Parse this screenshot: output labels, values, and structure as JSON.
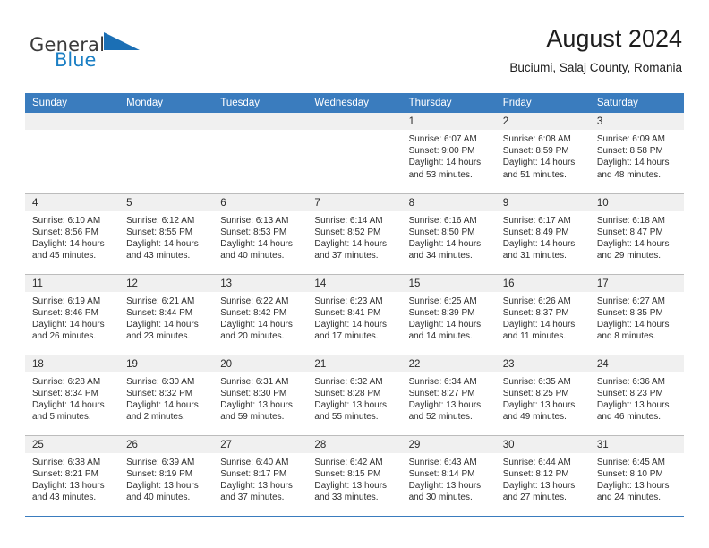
{
  "brand": {
    "name_part1": "General",
    "name_part2": "Blue",
    "accent_color": "#1b7fc4",
    "logo_icon": "triangle-flag-icon"
  },
  "header": {
    "title": "August 2024",
    "subtitle": "Buciumi, Salaj County, Romania",
    "header_bg_color": "#3a7cbe",
    "daynum_band_color": "#f0f0f0"
  },
  "weekdays": [
    "Sunday",
    "Monday",
    "Tuesday",
    "Wednesday",
    "Thursday",
    "Friday",
    "Saturday"
  ],
  "labels": {
    "sunrise_prefix": "Sunrise:",
    "sunset_prefix": "Sunset:",
    "daylight_prefix": "Daylight:"
  },
  "weeks": [
    [
      {
        "blank": true
      },
      {
        "blank": true
      },
      {
        "blank": true
      },
      {
        "blank": true
      },
      {
        "day": "1",
        "sunrise": "Sunrise: 6:07 AM",
        "sunset": "Sunset: 9:00 PM",
        "daylight1": "Daylight: 14 hours",
        "daylight2": "and 53 minutes."
      },
      {
        "day": "2",
        "sunrise": "Sunrise: 6:08 AM",
        "sunset": "Sunset: 8:59 PM",
        "daylight1": "Daylight: 14 hours",
        "daylight2": "and 51 minutes."
      },
      {
        "day": "3",
        "sunrise": "Sunrise: 6:09 AM",
        "sunset": "Sunset: 8:58 PM",
        "daylight1": "Daylight: 14 hours",
        "daylight2": "and 48 minutes."
      }
    ],
    [
      {
        "day": "4",
        "sunrise": "Sunrise: 6:10 AM",
        "sunset": "Sunset: 8:56 PM",
        "daylight1": "Daylight: 14 hours",
        "daylight2": "and 45 minutes."
      },
      {
        "day": "5",
        "sunrise": "Sunrise: 6:12 AM",
        "sunset": "Sunset: 8:55 PM",
        "daylight1": "Daylight: 14 hours",
        "daylight2": "and 43 minutes."
      },
      {
        "day": "6",
        "sunrise": "Sunrise: 6:13 AM",
        "sunset": "Sunset: 8:53 PM",
        "daylight1": "Daylight: 14 hours",
        "daylight2": "and 40 minutes."
      },
      {
        "day": "7",
        "sunrise": "Sunrise: 6:14 AM",
        "sunset": "Sunset: 8:52 PM",
        "daylight1": "Daylight: 14 hours",
        "daylight2": "and 37 minutes."
      },
      {
        "day": "8",
        "sunrise": "Sunrise: 6:16 AM",
        "sunset": "Sunset: 8:50 PM",
        "daylight1": "Daylight: 14 hours",
        "daylight2": "and 34 minutes."
      },
      {
        "day": "9",
        "sunrise": "Sunrise: 6:17 AM",
        "sunset": "Sunset: 8:49 PM",
        "daylight1": "Daylight: 14 hours",
        "daylight2": "and 31 minutes."
      },
      {
        "day": "10",
        "sunrise": "Sunrise: 6:18 AM",
        "sunset": "Sunset: 8:47 PM",
        "daylight1": "Daylight: 14 hours",
        "daylight2": "and 29 minutes."
      }
    ],
    [
      {
        "day": "11",
        "sunrise": "Sunrise: 6:19 AM",
        "sunset": "Sunset: 8:46 PM",
        "daylight1": "Daylight: 14 hours",
        "daylight2": "and 26 minutes."
      },
      {
        "day": "12",
        "sunrise": "Sunrise: 6:21 AM",
        "sunset": "Sunset: 8:44 PM",
        "daylight1": "Daylight: 14 hours",
        "daylight2": "and 23 minutes."
      },
      {
        "day": "13",
        "sunrise": "Sunrise: 6:22 AM",
        "sunset": "Sunset: 8:42 PM",
        "daylight1": "Daylight: 14 hours",
        "daylight2": "and 20 minutes."
      },
      {
        "day": "14",
        "sunrise": "Sunrise: 6:23 AM",
        "sunset": "Sunset: 8:41 PM",
        "daylight1": "Daylight: 14 hours",
        "daylight2": "and 17 minutes."
      },
      {
        "day": "15",
        "sunrise": "Sunrise: 6:25 AM",
        "sunset": "Sunset: 8:39 PM",
        "daylight1": "Daylight: 14 hours",
        "daylight2": "and 14 minutes."
      },
      {
        "day": "16",
        "sunrise": "Sunrise: 6:26 AM",
        "sunset": "Sunset: 8:37 PM",
        "daylight1": "Daylight: 14 hours",
        "daylight2": "and 11 minutes."
      },
      {
        "day": "17",
        "sunrise": "Sunrise: 6:27 AM",
        "sunset": "Sunset: 8:35 PM",
        "daylight1": "Daylight: 14 hours",
        "daylight2": "and 8 minutes."
      }
    ],
    [
      {
        "day": "18",
        "sunrise": "Sunrise: 6:28 AM",
        "sunset": "Sunset: 8:34 PM",
        "daylight1": "Daylight: 14 hours",
        "daylight2": "and 5 minutes."
      },
      {
        "day": "19",
        "sunrise": "Sunrise: 6:30 AM",
        "sunset": "Sunset: 8:32 PM",
        "daylight1": "Daylight: 14 hours",
        "daylight2": "and 2 minutes."
      },
      {
        "day": "20",
        "sunrise": "Sunrise: 6:31 AM",
        "sunset": "Sunset: 8:30 PM",
        "daylight1": "Daylight: 13 hours",
        "daylight2": "and 59 minutes."
      },
      {
        "day": "21",
        "sunrise": "Sunrise: 6:32 AM",
        "sunset": "Sunset: 8:28 PM",
        "daylight1": "Daylight: 13 hours",
        "daylight2": "and 55 minutes."
      },
      {
        "day": "22",
        "sunrise": "Sunrise: 6:34 AM",
        "sunset": "Sunset: 8:27 PM",
        "daylight1": "Daylight: 13 hours",
        "daylight2": "and 52 minutes."
      },
      {
        "day": "23",
        "sunrise": "Sunrise: 6:35 AM",
        "sunset": "Sunset: 8:25 PM",
        "daylight1": "Daylight: 13 hours",
        "daylight2": "and 49 minutes."
      },
      {
        "day": "24",
        "sunrise": "Sunrise: 6:36 AM",
        "sunset": "Sunset: 8:23 PM",
        "daylight1": "Daylight: 13 hours",
        "daylight2": "and 46 minutes."
      }
    ],
    [
      {
        "day": "25",
        "sunrise": "Sunrise: 6:38 AM",
        "sunset": "Sunset: 8:21 PM",
        "daylight1": "Daylight: 13 hours",
        "daylight2": "and 43 minutes."
      },
      {
        "day": "26",
        "sunrise": "Sunrise: 6:39 AM",
        "sunset": "Sunset: 8:19 PM",
        "daylight1": "Daylight: 13 hours",
        "daylight2": "and 40 minutes."
      },
      {
        "day": "27",
        "sunrise": "Sunrise: 6:40 AM",
        "sunset": "Sunset: 8:17 PM",
        "daylight1": "Daylight: 13 hours",
        "daylight2": "and 37 minutes."
      },
      {
        "day": "28",
        "sunrise": "Sunrise: 6:42 AM",
        "sunset": "Sunset: 8:15 PM",
        "daylight1": "Daylight: 13 hours",
        "daylight2": "and 33 minutes."
      },
      {
        "day": "29",
        "sunrise": "Sunrise: 6:43 AM",
        "sunset": "Sunset: 8:14 PM",
        "daylight1": "Daylight: 13 hours",
        "daylight2": "and 30 minutes."
      },
      {
        "day": "30",
        "sunrise": "Sunrise: 6:44 AM",
        "sunset": "Sunset: 8:12 PM",
        "daylight1": "Daylight: 13 hours",
        "daylight2": "and 27 minutes."
      },
      {
        "day": "31",
        "sunrise": "Sunrise: 6:45 AM",
        "sunset": "Sunset: 8:10 PM",
        "daylight1": "Daylight: 13 hours",
        "daylight2": "and 24 minutes."
      }
    ]
  ]
}
